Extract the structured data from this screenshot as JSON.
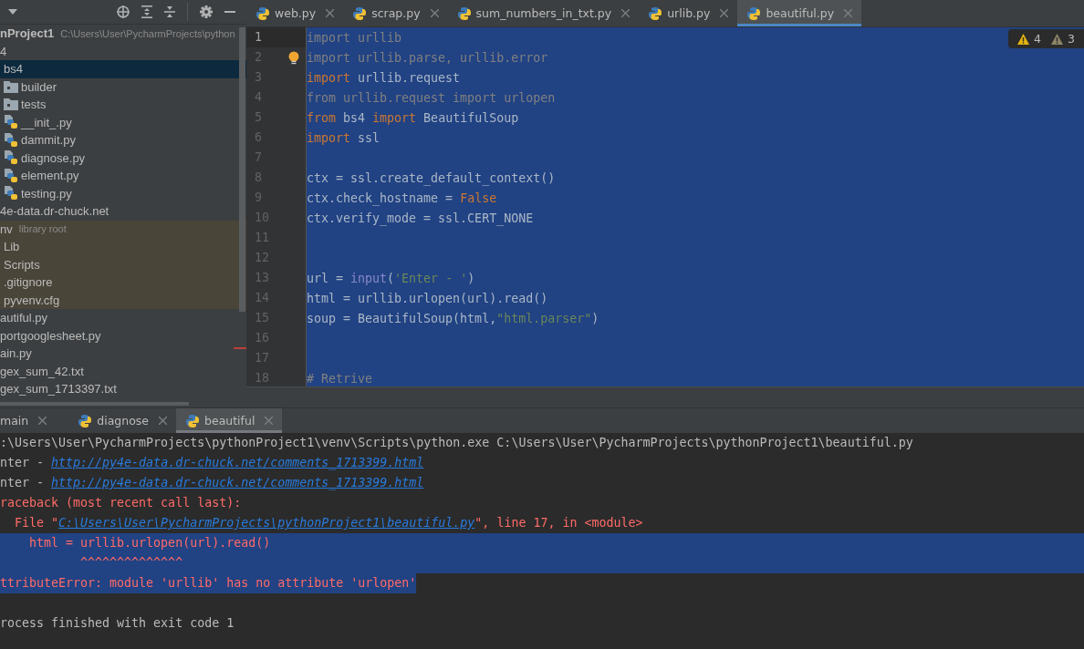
{
  "project_panel": {
    "tree": [
      {
        "name": "nProject1",
        "hint": "C:\\Users\\User\\PycharmProjects\\python",
        "selected": false,
        "highlighted": false,
        "children": [
          {
            "name": "4",
            "selected": false,
            "highlighted": false,
            "children": [
              {
                "name": "bs4",
                "selected": true,
                "highlighted": false,
                "children": [
                  {
                    "name": "builder",
                    "kind": "folder",
                    "selected": false,
                    "highlighted": false
                  },
                  {
                    "name": "tests",
                    "kind": "folder",
                    "selected": false,
                    "highlighted": false
                  },
                  {
                    "name": "__init_.py",
                    "kind": "python",
                    "selected": false,
                    "highlighted": false
                  },
                  {
                    "name": "dammit.py",
                    "kind": "python",
                    "selected": false,
                    "highlighted": false
                  },
                  {
                    "name": "diagnose.py",
                    "kind": "python",
                    "selected": false,
                    "highlighted": false
                  },
                  {
                    "name": "element.py",
                    "kind": "python",
                    "selected": false,
                    "highlighted": false
                  },
                  {
                    "name": "testing.py",
                    "kind": "python",
                    "selected": false,
                    "highlighted": false
                  }
                ]
              }
            ]
          },
          {
            "name": "4e-data.dr-chuck.net",
            "selected": false,
            "highlighted": false
          },
          {
            "name": "nv",
            "hint": "library root",
            "selected": false,
            "highlighted": true,
            "children": [
              {
                "name": "Lib",
                "selected": false,
                "highlighted": true
              },
              {
                "name": "Scripts",
                "selected": false,
                "highlighted": true
              },
              {
                "name": ".gitignore",
                "selected": false,
                "highlighted": true
              },
              {
                "name": "pyvenv.cfg",
                "selected": false,
                "highlighted": true
              }
            ]
          },
          {
            "name": "autiful.py",
            "selected": false,
            "highlighted": false
          },
          {
            "name": "portgooglesheet.py",
            "selected": false,
            "highlighted": false
          },
          {
            "name": "ain.py",
            "selected": false,
            "highlighted": false
          },
          {
            "name": "gex_sum_42.txt",
            "selected": false,
            "highlighted": false
          },
          {
            "name": "gex_sum_1713397.txt",
            "selected": false,
            "highlighted": false
          }
        ]
      }
    ]
  },
  "editor": {
    "tabs": [
      {
        "label": "web.py",
        "selected": false
      },
      {
        "label": "scrap.py",
        "selected": false
      },
      {
        "label": "sum_numbers_in_txt.py",
        "selected": false
      },
      {
        "label": "urlib.py",
        "selected": false
      },
      {
        "label": "beautiful.py",
        "selected": true
      }
    ],
    "inspections": [
      {
        "kind": "warning",
        "count": "4"
      },
      {
        "kind": "weak",
        "count": "3"
      }
    ],
    "lines": [
      {
        "number": "1",
        "current": true,
        "tokens": [
          {
            "kind": "dim",
            "text": "import urllib"
          }
        ]
      },
      {
        "number": "2",
        "current": false,
        "tokens": [
          {
            "kind": "dim",
            "text": "import urllib.parse, urllib.error"
          }
        ]
      },
      {
        "number": "3",
        "current": false,
        "tokens": [
          {
            "kind": "kw",
            "text": "import"
          },
          {
            "kind": "plain",
            "text": " urllib.request"
          }
        ]
      },
      {
        "number": "4",
        "current": false,
        "tokens": [
          {
            "kind": "dim",
            "text": "from urllib.request import urlopen"
          }
        ]
      },
      {
        "number": "5",
        "current": false,
        "tokens": [
          {
            "kind": "kw",
            "text": "from"
          },
          {
            "kind": "plain",
            "text": " bs4 "
          },
          {
            "kind": "kw",
            "text": "import"
          },
          {
            "kind": "plain",
            "text": " BeautifulSoup"
          }
        ]
      },
      {
        "number": "6",
        "current": false,
        "tokens": [
          {
            "kind": "kw",
            "text": "import"
          },
          {
            "kind": "plain",
            "text": " ssl"
          }
        ]
      },
      {
        "number": "7",
        "current": false
      },
      {
        "number": "8",
        "current": false,
        "tokens": [
          {
            "kind": "plain",
            "text": "ctx = ssl.create_default_context()"
          }
        ]
      },
      {
        "number": "9",
        "current": false,
        "tokens": [
          {
            "kind": "plain",
            "text": "ctx.check_hostname = "
          },
          {
            "kind": "kw",
            "text": "False"
          }
        ]
      },
      {
        "number": "10",
        "current": false,
        "tokens": [
          {
            "kind": "plain",
            "text": "ctx.verify_mode = ssl.CERT_NONE"
          }
        ]
      },
      {
        "number": "11",
        "current": false
      },
      {
        "number": "12",
        "current": false
      },
      {
        "number": "13",
        "current": false,
        "tokens": [
          {
            "kind": "plain",
            "text": "url = "
          },
          {
            "kind": "builtin",
            "text": "input"
          },
          {
            "kind": "plain",
            "text": "("
          },
          {
            "kind": "str",
            "text": "'Enter - '"
          },
          {
            "kind": "plain",
            "text": ")"
          }
        ]
      },
      {
        "number": "14",
        "current": false,
        "tokens": [
          {
            "kind": "plain",
            "text": "html = urllib.urlopen(url).read()"
          }
        ]
      },
      {
        "number": "15",
        "current": false,
        "tokens": [
          {
            "kind": "plain",
            "text": "soup = BeautifulSoup(html,"
          },
          {
            "kind": "str",
            "text": "\"html.parser\""
          },
          {
            "kind": "plain",
            "text": ")"
          }
        ]
      },
      {
        "number": "16",
        "current": false
      },
      {
        "number": "17",
        "current": false
      },
      {
        "number": "18",
        "current": false,
        "tokens": [
          {
            "kind": "dim",
            "text": "# Retrive"
          }
        ]
      }
    ]
  },
  "run_panel": {
    "tabs": [
      {
        "label": "main",
        "icon": false,
        "selected": false
      },
      {
        "label": "diagnose",
        "icon": true,
        "selected": false
      },
      {
        "label": "beautiful",
        "icon": true,
        "selected": true
      }
    ],
    "console": [
      {
        "selected": false,
        "segments": [
          {
            "kind": "plain",
            "text": ":\\Users\\User\\PycharmProjects\\pythonProject1\\venv\\Scripts\\python.exe C:\\Users\\User\\PycharmProjects\\pythonProject1\\beautiful.py"
          }
        ]
      },
      {
        "selected": false,
        "segments": [
          {
            "kind": "plain",
            "text": "nter - "
          },
          {
            "kind": "link",
            "text": "http://py4e-data.dr-chuck.net/comments_1713399.html"
          }
        ]
      },
      {
        "selected": false,
        "segments": [
          {
            "kind": "plain",
            "text": "nter - "
          },
          {
            "kind": "link",
            "text": "http://py4e-data.dr-chuck.net/comments_1713399.html"
          }
        ]
      },
      {
        "selected": false,
        "segments": [
          {
            "kind": "error",
            "text": "raceback (most recent call last):"
          }
        ]
      },
      {
        "selected": false,
        "segments": [
          {
            "kind": "error",
            "text": "  File \""
          },
          {
            "kind": "link",
            "text": "C:\\Users\\User\\PycharmProjects\\pythonProject1\\beautiful.py"
          },
          {
            "kind": "error",
            "text": "\", line 17, in <module>"
          }
        ]
      },
      {
        "selected": true,
        "segments": [
          {
            "kind": "error",
            "text": "    html = urllib.urlopen(url).read()"
          }
        ]
      },
      {
        "selected": true,
        "segments": [
          {
            "kind": "error",
            "text": "           ^^^^^^^^^^^^^^"
          }
        ]
      },
      {
        "selected": true,
        "segments": [
          {
            "kind": "error",
            "text": "ttributeError: module 'urllib' has no attribute 'urlopen'"
          }
        ]
      },
      {
        "selected": false
      },
      {
        "selected": false,
        "segments": [
          {
            "kind": "plain",
            "text": "rocess finished with exit code 1"
          }
        ]
      }
    ]
  }
}
